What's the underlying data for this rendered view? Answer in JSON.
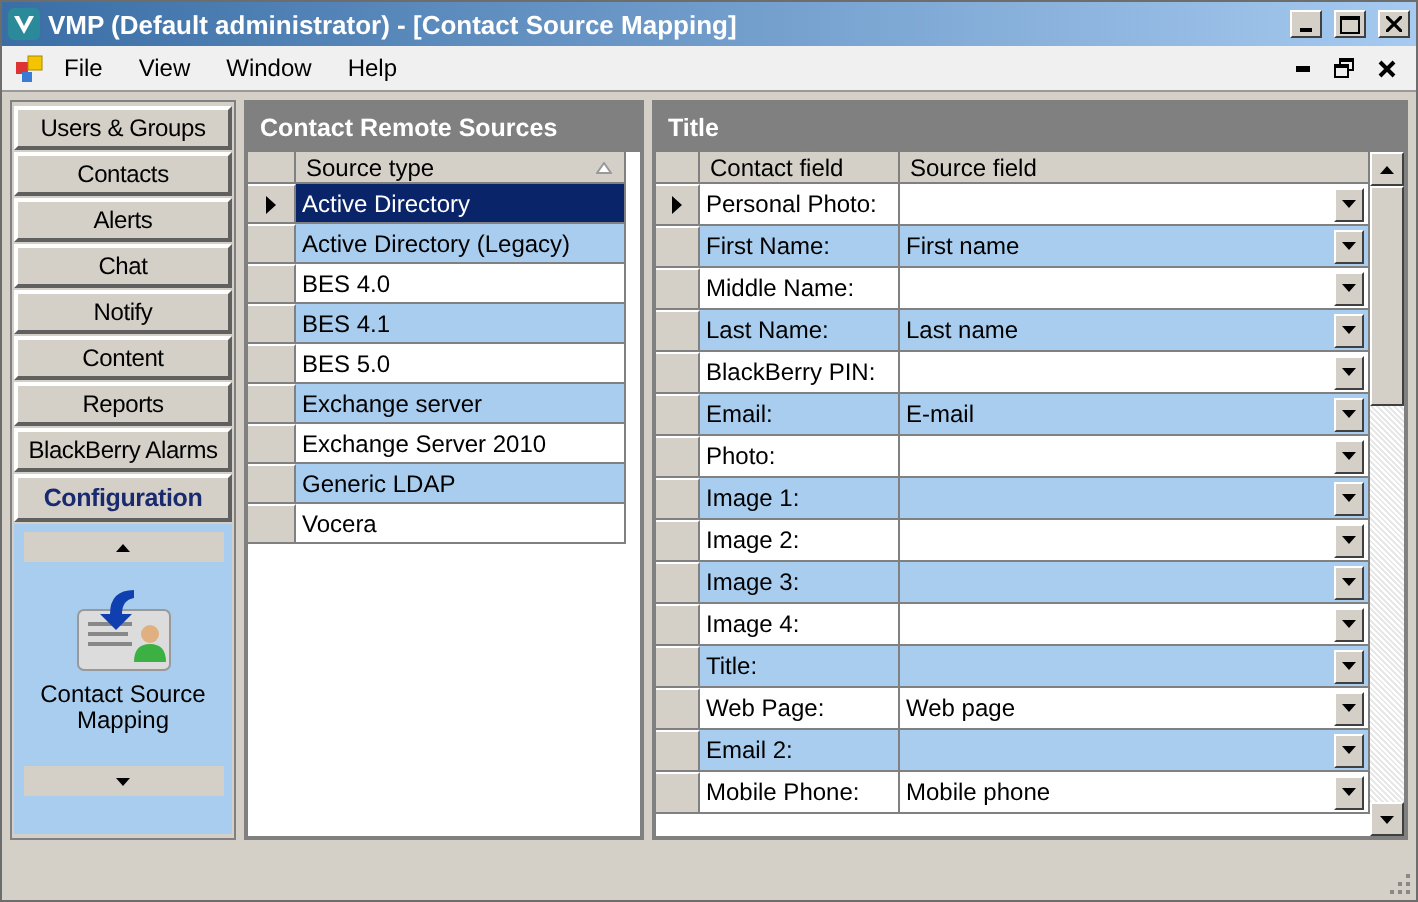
{
  "window": {
    "title": "VMP (Default administrator) - [Contact Source Mapping]"
  },
  "menu": [
    "File",
    "View",
    "Window",
    "Help"
  ],
  "nav": {
    "items": [
      {
        "label": "Users & Groups",
        "selected": false
      },
      {
        "label": "Contacts",
        "selected": false
      },
      {
        "label": "Alerts",
        "selected": false
      },
      {
        "label": "Chat",
        "selected": false
      },
      {
        "label": "Notify",
        "selected": false
      },
      {
        "label": "Content",
        "selected": false
      },
      {
        "label": "Reports",
        "selected": false
      },
      {
        "label": "BlackBerry Alarms",
        "selected": false
      },
      {
        "label": "Configuration",
        "selected": true
      }
    ],
    "tool": {
      "label": "Contact Source Mapping"
    }
  },
  "sources": {
    "title": "Contact Remote Sources",
    "column": "Source type",
    "rows": [
      {
        "name": "Active Directory",
        "selected": true
      },
      {
        "name": "Active Directory (Legacy)",
        "selected": false
      },
      {
        "name": "BES 4.0",
        "selected": false
      },
      {
        "name": "BES 4.1",
        "selected": false
      },
      {
        "name": "BES 5.0",
        "selected": false
      },
      {
        "name": "Exchange server",
        "selected": false
      },
      {
        "name": "Exchange Server 2010",
        "selected": false
      },
      {
        "name": "Generic LDAP",
        "selected": false
      },
      {
        "name": "Vocera",
        "selected": false
      }
    ]
  },
  "mapping": {
    "title": "Title",
    "columns": [
      "Contact field",
      "Source field"
    ],
    "rows": [
      {
        "field": "Personal Photo:",
        "current": true
      },
      {
        "field": "First Name:",
        "source": "First name",
        "current": false
      },
      {
        "field": "Middle Name:",
        "current": false
      },
      {
        "field": "Last Name:",
        "source": "Last name",
        "current": false
      },
      {
        "field": "BlackBerry PIN:",
        "current": false
      },
      {
        "field": "Email:",
        "source": "E-mail",
        "current": false
      },
      {
        "field": "Photo:",
        "current": false
      },
      {
        "field": "Image 1:",
        "current": false
      },
      {
        "field": "Image 2:",
        "current": false
      },
      {
        "field": "Image 3:",
        "current": false
      },
      {
        "field": "Image 4:",
        "current": false
      },
      {
        "field": "Title:",
        "current": false
      },
      {
        "field": "Web Page:",
        "source": "Web page",
        "current": false
      },
      {
        "field": "Email 2:",
        "current": false
      },
      {
        "field": "Mobile Phone:",
        "source": "Mobile phone",
        "current": false
      }
    ]
  }
}
